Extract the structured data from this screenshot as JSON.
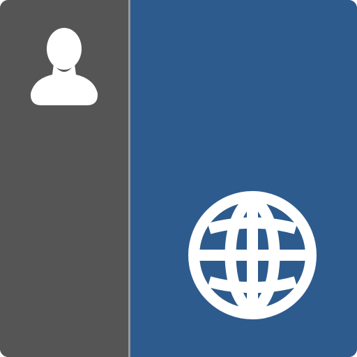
{
  "icons": {
    "profile": "person-silhouette-icon",
    "web": "globe-icon"
  },
  "colors": {
    "left_panel": "#555555",
    "right_panel": "#2d5b8e",
    "divider": "#9a9a9a",
    "icon_fill": "#ffffff"
  }
}
